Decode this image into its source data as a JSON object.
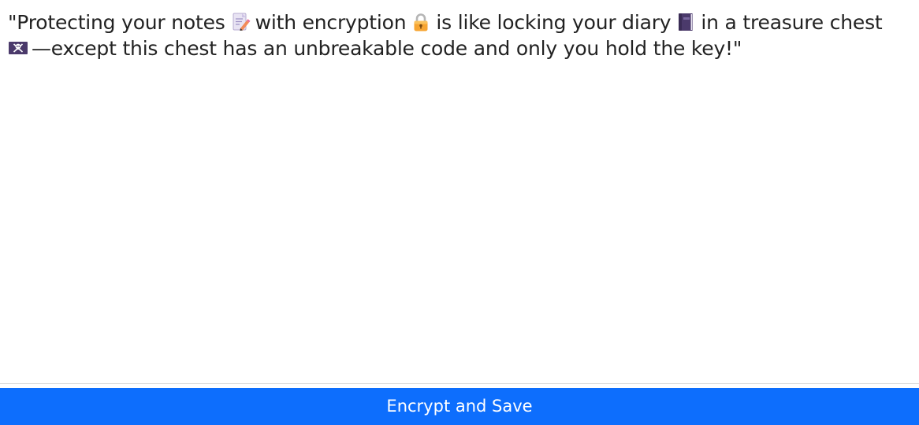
{
  "note": {
    "segments": [
      "\"Protecting your notes",
      "with encryption",
      "is like locking your diary",
      "in a treasure chest",
      "—except this chest has an unbreakable code and only you hold the key!\""
    ],
    "emojis": [
      "memo-icon",
      "lock-icon",
      "notebook-icon",
      "pirate-flag-icon"
    ]
  },
  "save_button": {
    "label": "Encrypt and Save",
    "color": "#0d6efd"
  }
}
